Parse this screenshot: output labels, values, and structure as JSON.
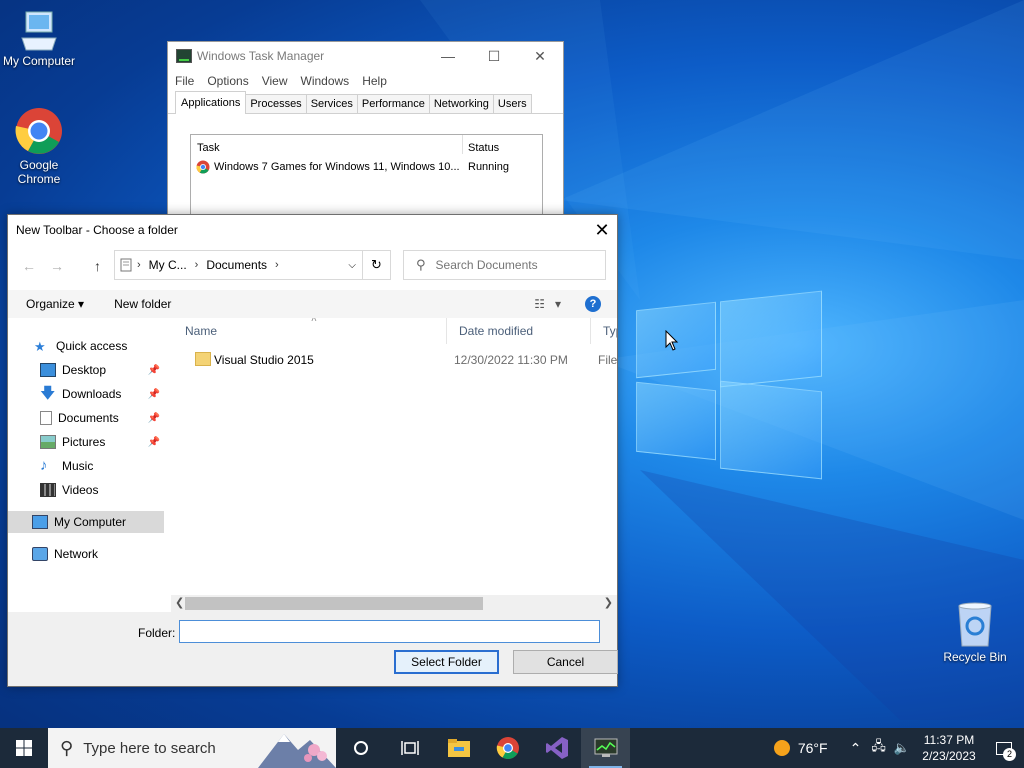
{
  "desktop": {
    "icons": [
      {
        "label": "My Computer",
        "icon": "computer-icon"
      },
      {
        "label": "Google Chrome",
        "icon": "chrome-icon"
      },
      {
        "label": "Recycle Bin",
        "icon": "recycle-bin-icon"
      }
    ]
  },
  "task_manager": {
    "title": "Windows Task Manager",
    "menu": [
      "File",
      "Options",
      "View",
      "Windows",
      "Help"
    ],
    "tabs": [
      "Applications",
      "Processes",
      "Services",
      "Performance",
      "Networking",
      "Users"
    ],
    "active_tab": "Applications",
    "columns": [
      "Task",
      "Status"
    ],
    "rows": [
      {
        "task": "Windows 7 Games for Windows 11, Windows 10...",
        "status": "Running"
      }
    ]
  },
  "dialog": {
    "title": "New Toolbar - Choose a folder",
    "address": {
      "segments": [
        "My C...",
        "Documents"
      ]
    },
    "search_placeholder": "Search Documents",
    "commands": {
      "organize": "Organize",
      "new_folder": "New folder"
    },
    "nav": [
      {
        "label": "Quick access",
        "icon": "star-icon"
      },
      {
        "label": "Desktop",
        "icon": "desktop-icon",
        "pinned": true
      },
      {
        "label": "Downloads",
        "icon": "download-icon",
        "pinned": true
      },
      {
        "label": "Documents",
        "icon": "documents-icon",
        "pinned": true
      },
      {
        "label": "Pictures",
        "icon": "pictures-icon",
        "pinned": true
      },
      {
        "label": "Music",
        "icon": "music-icon"
      },
      {
        "label": "Videos",
        "icon": "videos-icon"
      },
      {
        "label": "My Computer",
        "icon": "computer-icon",
        "selected": true
      },
      {
        "label": "Network",
        "icon": "network-icon"
      }
    ],
    "columns": [
      "Name",
      "Date modified",
      "Type"
    ],
    "files": [
      {
        "name": "Visual Studio 2015",
        "date": "12/30/2022 11:30 PM",
        "type": "File fo"
      }
    ],
    "folder_label": "Folder:",
    "folder_value": "",
    "buttons": {
      "select": "Select Folder",
      "cancel": "Cancel"
    }
  },
  "taskbar": {
    "search_placeholder": "Type here to search",
    "weather": "76°F",
    "time": "11:37 PM",
    "date": "2/23/2023",
    "notification_count": "2"
  }
}
